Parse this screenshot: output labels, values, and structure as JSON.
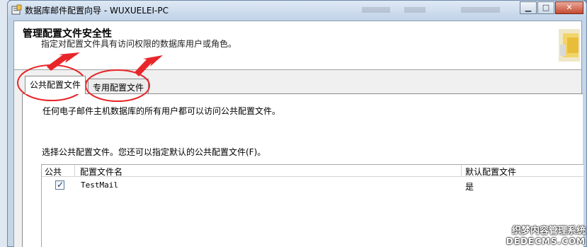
{
  "window": {
    "title": "数据库邮件配置向导 - WUXUELEI-PC",
    "controls": {
      "minimize": "▁",
      "maximize": "□",
      "close": "✕"
    }
  },
  "header": {
    "title": "管理配置文件安全性",
    "subtitle": "指定对配置文件具有访问权限的数据库用户或角色。"
  },
  "tabs": [
    {
      "label": "公共配置文件",
      "active": true
    },
    {
      "label": "专用配置文件",
      "active": false
    }
  ],
  "panel": {
    "description": "任何电子邮件主机数据库的所有用户都可以访问公共配置文件。",
    "instruction": "选择公共配置文件。您还可以指定默认的公共配置文件(F)。"
  },
  "table": {
    "columns": [
      "公共",
      "配置文件名",
      "默认配置文件"
    ],
    "rows": [
      {
        "public": true,
        "name": "TestMail",
        "default": "是"
      }
    ]
  },
  "watermark": {
    "line1": "织梦内容管理系统",
    "line2": "DEDECMS.COM"
  },
  "colors": {
    "annotation": "#e8262a",
    "window_frame": "#c4d5e8",
    "close_button": "#c44a30"
  },
  "icons": [
    "wizard-app-icon",
    "wizard-logo-icon",
    "minimize-icon",
    "maximize-icon",
    "close-icon",
    "checkbox-checked-icon",
    "red-arrow-annotation"
  ]
}
